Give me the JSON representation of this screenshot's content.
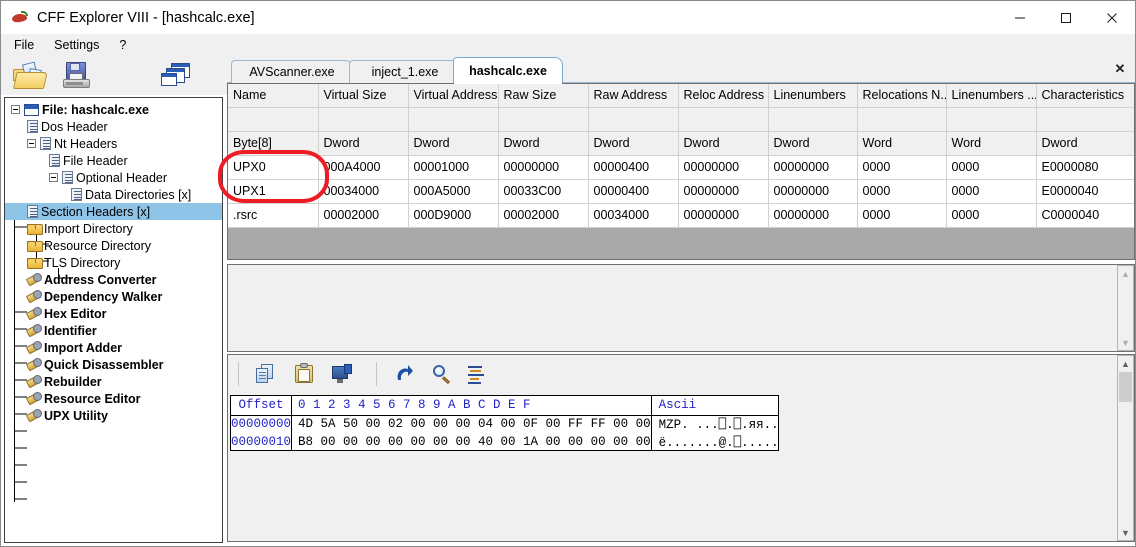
{
  "window": {
    "title": "CFF Explorer VIII - [hashcalc.exe]",
    "app_icon": "chili-pepper-icon",
    "minimize_label": "—",
    "maximize_label": "□",
    "close_label": "✕"
  },
  "menu": {
    "items": [
      {
        "label": "File"
      },
      {
        "label": "Settings"
      },
      {
        "label": "?"
      }
    ]
  },
  "toolbar": {
    "buttons": [
      {
        "name": "open-file-icon",
        "tooltip": "Open"
      },
      {
        "name": "save-file-icon",
        "tooltip": "Save"
      },
      {
        "name": "cascade-windows-icon",
        "tooltip": "Windows"
      }
    ]
  },
  "sidebar": {
    "items": [
      {
        "label": "File: hashcalc.exe",
        "icon": "window-icon",
        "indent": 0,
        "bold": true,
        "expander": "minus",
        "selected": false
      },
      {
        "label": "Dos Header",
        "icon": "document-icon",
        "indent": 1,
        "bold": false,
        "expander": "none",
        "selected": false
      },
      {
        "label": "Nt Headers",
        "icon": "document-icon",
        "indent": 1,
        "bold": false,
        "expander": "minus",
        "selected": false
      },
      {
        "label": "File Header",
        "icon": "document-icon",
        "indent": 2,
        "bold": false,
        "expander": "none",
        "selected": false
      },
      {
        "label": "Optional Header",
        "icon": "document-icon",
        "indent": 2,
        "bold": false,
        "expander": "minus",
        "selected": false
      },
      {
        "label": "Data Directories [x]",
        "icon": "document-icon",
        "indent": 3,
        "bold": false,
        "expander": "none",
        "selected": false
      },
      {
        "label": "Section Headers [x]",
        "icon": "document-icon",
        "indent": 1,
        "bold": false,
        "expander": "none",
        "selected": true
      },
      {
        "label": "Import Directory",
        "icon": "folder-icon",
        "indent": 1,
        "bold": false,
        "expander": "none",
        "selected": false
      },
      {
        "label": "Resource Directory",
        "icon": "folder-icon",
        "indent": 1,
        "bold": false,
        "expander": "none",
        "selected": false
      },
      {
        "label": "TLS Directory",
        "icon": "folder-icon",
        "indent": 1,
        "bold": false,
        "expander": "none",
        "selected": false
      },
      {
        "label": "Address Converter",
        "icon": "tool-icon",
        "indent": 1,
        "bold": true,
        "expander": "none",
        "selected": false
      },
      {
        "label": "Dependency Walker",
        "icon": "tool-icon",
        "indent": 1,
        "bold": true,
        "expander": "none",
        "selected": false
      },
      {
        "label": "Hex Editor",
        "icon": "tool-icon",
        "indent": 1,
        "bold": true,
        "expander": "none",
        "selected": false
      },
      {
        "label": "Identifier",
        "icon": "tool-icon",
        "indent": 1,
        "bold": true,
        "expander": "none",
        "selected": false
      },
      {
        "label": "Import Adder",
        "icon": "tool-icon",
        "indent": 1,
        "bold": true,
        "expander": "none",
        "selected": false
      },
      {
        "label": "Quick Disassembler",
        "icon": "tool-icon",
        "indent": 1,
        "bold": true,
        "expander": "none",
        "selected": false
      },
      {
        "label": "Rebuilder",
        "icon": "tool-icon",
        "indent": 1,
        "bold": true,
        "expander": "none",
        "selected": false
      },
      {
        "label": "Resource Editor",
        "icon": "tool-icon",
        "indent": 1,
        "bold": true,
        "expander": "none",
        "selected": false
      },
      {
        "label": "UPX Utility",
        "icon": "tool-icon",
        "indent": 1,
        "bold": true,
        "expander": "none",
        "selected": false
      }
    ]
  },
  "tabs": {
    "close_label": "✕",
    "items": [
      {
        "label": "AVScanner.exe",
        "active": false
      },
      {
        "label": "inject_1.exe",
        "active": false
      },
      {
        "label": "hashcalc.exe",
        "active": true
      }
    ]
  },
  "section_table": {
    "columns": [
      "Name",
      "Virtual Size",
      "Virtual Address",
      "Raw Size",
      "Raw Address",
      "Reloc Address",
      "Linenumbers",
      "Relocations N...",
      "Linenumbers ...",
      "Characteristics"
    ],
    "types": [
      "Byte[8]",
      "Dword",
      "Dword",
      "Dword",
      "Dword",
      "Dword",
      "Dword",
      "Word",
      "Word",
      "Dword"
    ],
    "rows": [
      [
        "UPX0",
        "000A4000",
        "00001000",
        "00000000",
        "00000400",
        "00000000",
        "00000000",
        "0000",
        "0000",
        "E0000080"
      ],
      [
        "UPX1",
        "00034000",
        "000A5000",
        "00033C00",
        "00000400",
        "00000000",
        "00000000",
        "0000",
        "0000",
        "E0000040"
      ],
      [
        ".rsrc",
        "00002000",
        "000D9000",
        "00002000",
        "00034000",
        "00000000",
        "00000000",
        "0000",
        "0000",
        "C0000040"
      ]
    ],
    "selected_column_index": 9
  },
  "hex_toolbar": {
    "buttons": [
      {
        "name": "copy-icon"
      },
      {
        "name": "paste-icon"
      },
      {
        "name": "monitor-icon"
      },
      {
        "name": "redo-arrow-icon"
      },
      {
        "name": "magnifier-icon"
      },
      {
        "name": "list-view-icon"
      }
    ]
  },
  "hex_view": {
    "offset_header": "Offset",
    "ascii_header": "Ascii",
    "column_headers": [
      "0",
      "1",
      "2",
      "3",
      "4",
      "5",
      "6",
      "7",
      "8",
      "9",
      "A",
      "B",
      "C",
      "D",
      "E",
      "F"
    ],
    "rows": [
      {
        "offset": "00000000",
        "bytes": "4D 5A 50 00 02 00 00 00 04 00 0F 00 FF FF 00 00",
        "ascii": "MZP. ...⎕.⎕.яя.."
      },
      {
        "offset": "00000010",
        "bytes": "B8 00 00 00 00 00 00 00 40 00 1A 00 00 00 00 00",
        "ascii": "ë.......@.⎕....."
      }
    ]
  },
  "annotation": {
    "name": "red-highlight-ellipse",
    "color": "#ee1c25",
    "targets": [
      "UPX0",
      "UPX1"
    ]
  },
  "colors": {
    "selection_blue": "#8ec4e8",
    "cell_selection": "#aec6e8",
    "panel_gray": "#f0f0f0",
    "table_void": "#a9a9a9",
    "hex_blue": "#2323c8"
  }
}
